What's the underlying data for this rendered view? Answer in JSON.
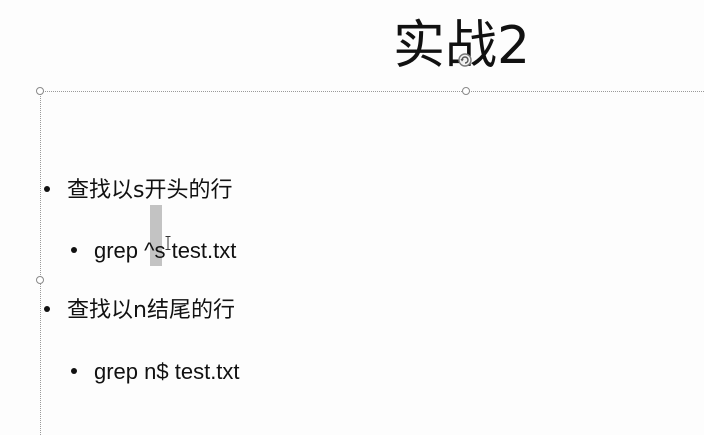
{
  "slide": {
    "title": "实战2",
    "bullets": [
      {
        "level": 1,
        "text": "查找以s开头的行"
      },
      {
        "level": 2,
        "text": "grep ^s test.txt"
      },
      {
        "level": 1,
        "text": "查找以n结尾的行"
      },
      {
        "level": 2,
        "text": "grep n$ test.txt"
      }
    ]
  },
  "icons": {
    "rotate": "rotate-handle-icon",
    "cursor": "text-cursor-icon"
  },
  "colors": {
    "selection": "#c3c3c3",
    "frame": "#9a9a9a",
    "text": "#111111"
  }
}
